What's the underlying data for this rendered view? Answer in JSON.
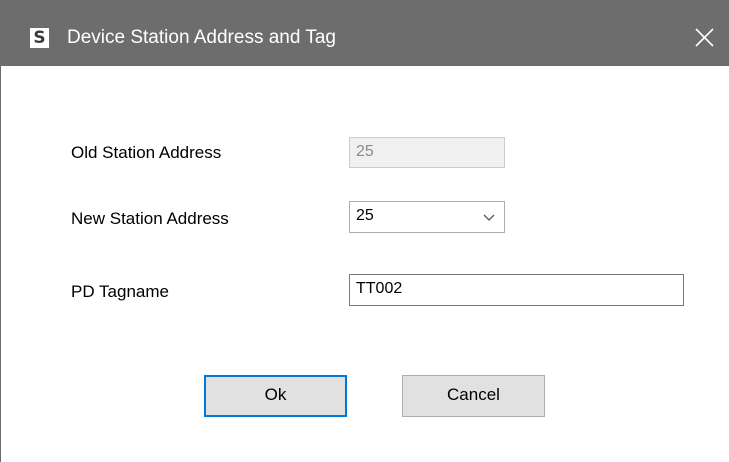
{
  "window": {
    "title": "Device Station Address and Tag",
    "app_icon_letter": "S",
    "titlebar_color": "#6d6d6d"
  },
  "form": {
    "old_station_address": {
      "label": "Old Station Address",
      "value": "25",
      "disabled": true
    },
    "new_station_address": {
      "label": "New Station Address",
      "selected": "25"
    },
    "pd_tagname": {
      "label": "PD Tagname",
      "value": "TT002"
    }
  },
  "buttons": {
    "ok_label": "Ok",
    "cancel_label": "Cancel",
    "focus_color": "#0078d7"
  },
  "icons": {
    "app": "app-s-icon",
    "close": "close-icon",
    "dropdown": "chevron-down-icon"
  }
}
